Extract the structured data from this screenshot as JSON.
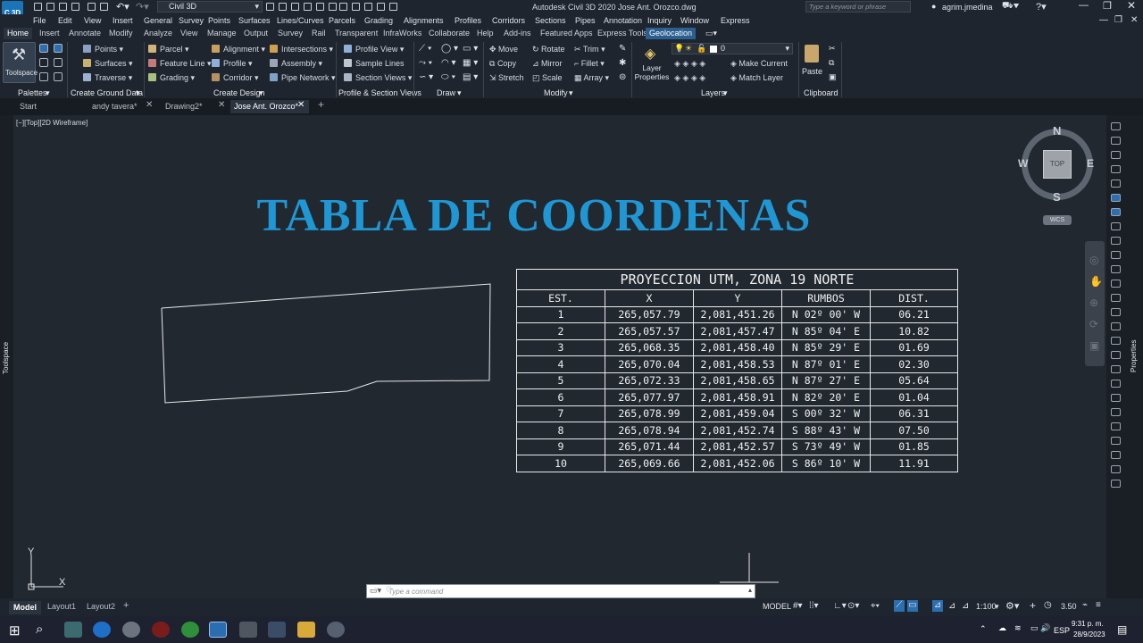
{
  "app": {
    "logo": "C 3D",
    "workspace": "Civil 3D",
    "title": "Autodesk Civil 3D 2020   Jose Ant. Orozco.dwg",
    "search_placeholder": "Type a keyword or phrase",
    "user": "agrim.jmedina"
  },
  "menu": [
    "File",
    "Edit",
    "View",
    "Insert",
    "General",
    "Survey",
    "Points",
    "Surfaces",
    "Lines/Curves",
    "Parcels",
    "Grading",
    "Alignments",
    "Profiles",
    "Corridors",
    "Sections",
    "Pipes",
    "Annotation",
    "Inquiry",
    "Window",
    "Express"
  ],
  "ribbon_tabs": [
    "Home",
    "Insert",
    "Annotate",
    "Modify",
    "Analyze",
    "View",
    "Manage",
    "Output",
    "Survey",
    "Rail",
    "Transparent",
    "InfraWorks",
    "Collaborate",
    "Help",
    "Add-ins",
    "Featured Apps",
    "Express Tools",
    "Geolocation"
  ],
  "ribbon": {
    "toolspace": "Toolspace",
    "ground": {
      "points": "Points",
      "surfaces": "Surfaces",
      "traverse": "Traverse"
    },
    "design1": {
      "parcel": "Parcel",
      "feature_line": "Feature Line",
      "grading": "Grading"
    },
    "design2": {
      "alignment": "Alignment",
      "profile": "Profile",
      "corridor": "Corridor"
    },
    "design3": {
      "intersections": "Intersections",
      "assembly": "Assembly",
      "pipe_network": "Pipe Network"
    },
    "profile_section": {
      "profile_view": "Profile View",
      "sample_lines": "Sample Lines",
      "section_views": "Section Views"
    },
    "modify1": {
      "move": "Move",
      "copy": "Copy",
      "stretch": "Stretch"
    },
    "modify2": {
      "rotate": "Rotate",
      "mirror": "Mirror",
      "scale": "Scale"
    },
    "modify3": {
      "trim": "Trim",
      "fillet": "Fillet",
      "array": "Array"
    },
    "layers": {
      "layer_properties": "Layer Properties",
      "current_layer": "0",
      "make_current": "Make Current",
      "match_layer": "Match Layer"
    },
    "clipboard": {
      "paste": "Paste"
    },
    "panels": [
      "Palettes",
      "Create Ground Data",
      "Create Design",
      "Profile & Section Views",
      "Draw",
      "Modify",
      "Layers",
      "Clipboard"
    ]
  },
  "doc_tabs": [
    "Start",
    "andy tavera*",
    "Drawing2*",
    "Jose Ant. Orozco*"
  ],
  "viewport_label": "[−][Top][2D Wireframe]",
  "viewcube": {
    "n": "N",
    "s": "S",
    "e": "E",
    "w": "W",
    "top": "TOP",
    "wcs": "WCS"
  },
  "left_palette": "Toolspace",
  "right_palette": "Properties",
  "drawing_title": "TABLA DE COORDENAS",
  "table": {
    "caption": "PROYECCION UTM, ZONA 19 NORTE",
    "headers": [
      "EST.",
      "X",
      "Y",
      "RUMBOS",
      "DIST."
    ],
    "rows": [
      [
        "1",
        "265,057.79",
        "2,081,451.26",
        "N 02º 00' W",
        "06.21"
      ],
      [
        "2",
        "265,057.57",
        "2,081,457.47",
        "N 85º 04' E",
        "10.82"
      ],
      [
        "3",
        "265,068.35",
        "2,081,458.40",
        "N 85º 29' E",
        "01.69"
      ],
      [
        "4",
        "265,070.04",
        "2,081,458.53",
        "N 87º 01' E",
        "02.30"
      ],
      [
        "5",
        "265,072.33",
        "2,081,458.65",
        "N 87º 27' E",
        "05.64"
      ],
      [
        "6",
        "265,077.97",
        "2,081,458.91",
        "N 82º 20' E",
        "01.04"
      ],
      [
        "7",
        "265,078.99",
        "2,081,459.04",
        "S 00º 32' W",
        "06.31"
      ],
      [
        "8",
        "265,078.94",
        "2,081,452.74",
        "S 88º 43' W",
        "07.50"
      ],
      [
        "9",
        "265,071.44",
        "2,081,452.57",
        "S 73º 49' W",
        "01.85"
      ],
      [
        "10",
        "265,069.66",
        "2,081,452.06",
        "S 86º 10' W",
        "11.91"
      ]
    ]
  },
  "ucs": {
    "x": "X",
    "y": "Y"
  },
  "command": {
    "placeholder": "Type a command"
  },
  "layout_tabs": [
    "Model",
    "Layout1",
    "Layout2"
  ],
  "status": {
    "model": "MODEL",
    "scale": "1:100",
    "lineweight": "3.50",
    "language": "ESP"
  },
  "clock": {
    "time": "9:31 p. m.",
    "date": "28/9/2023"
  }
}
